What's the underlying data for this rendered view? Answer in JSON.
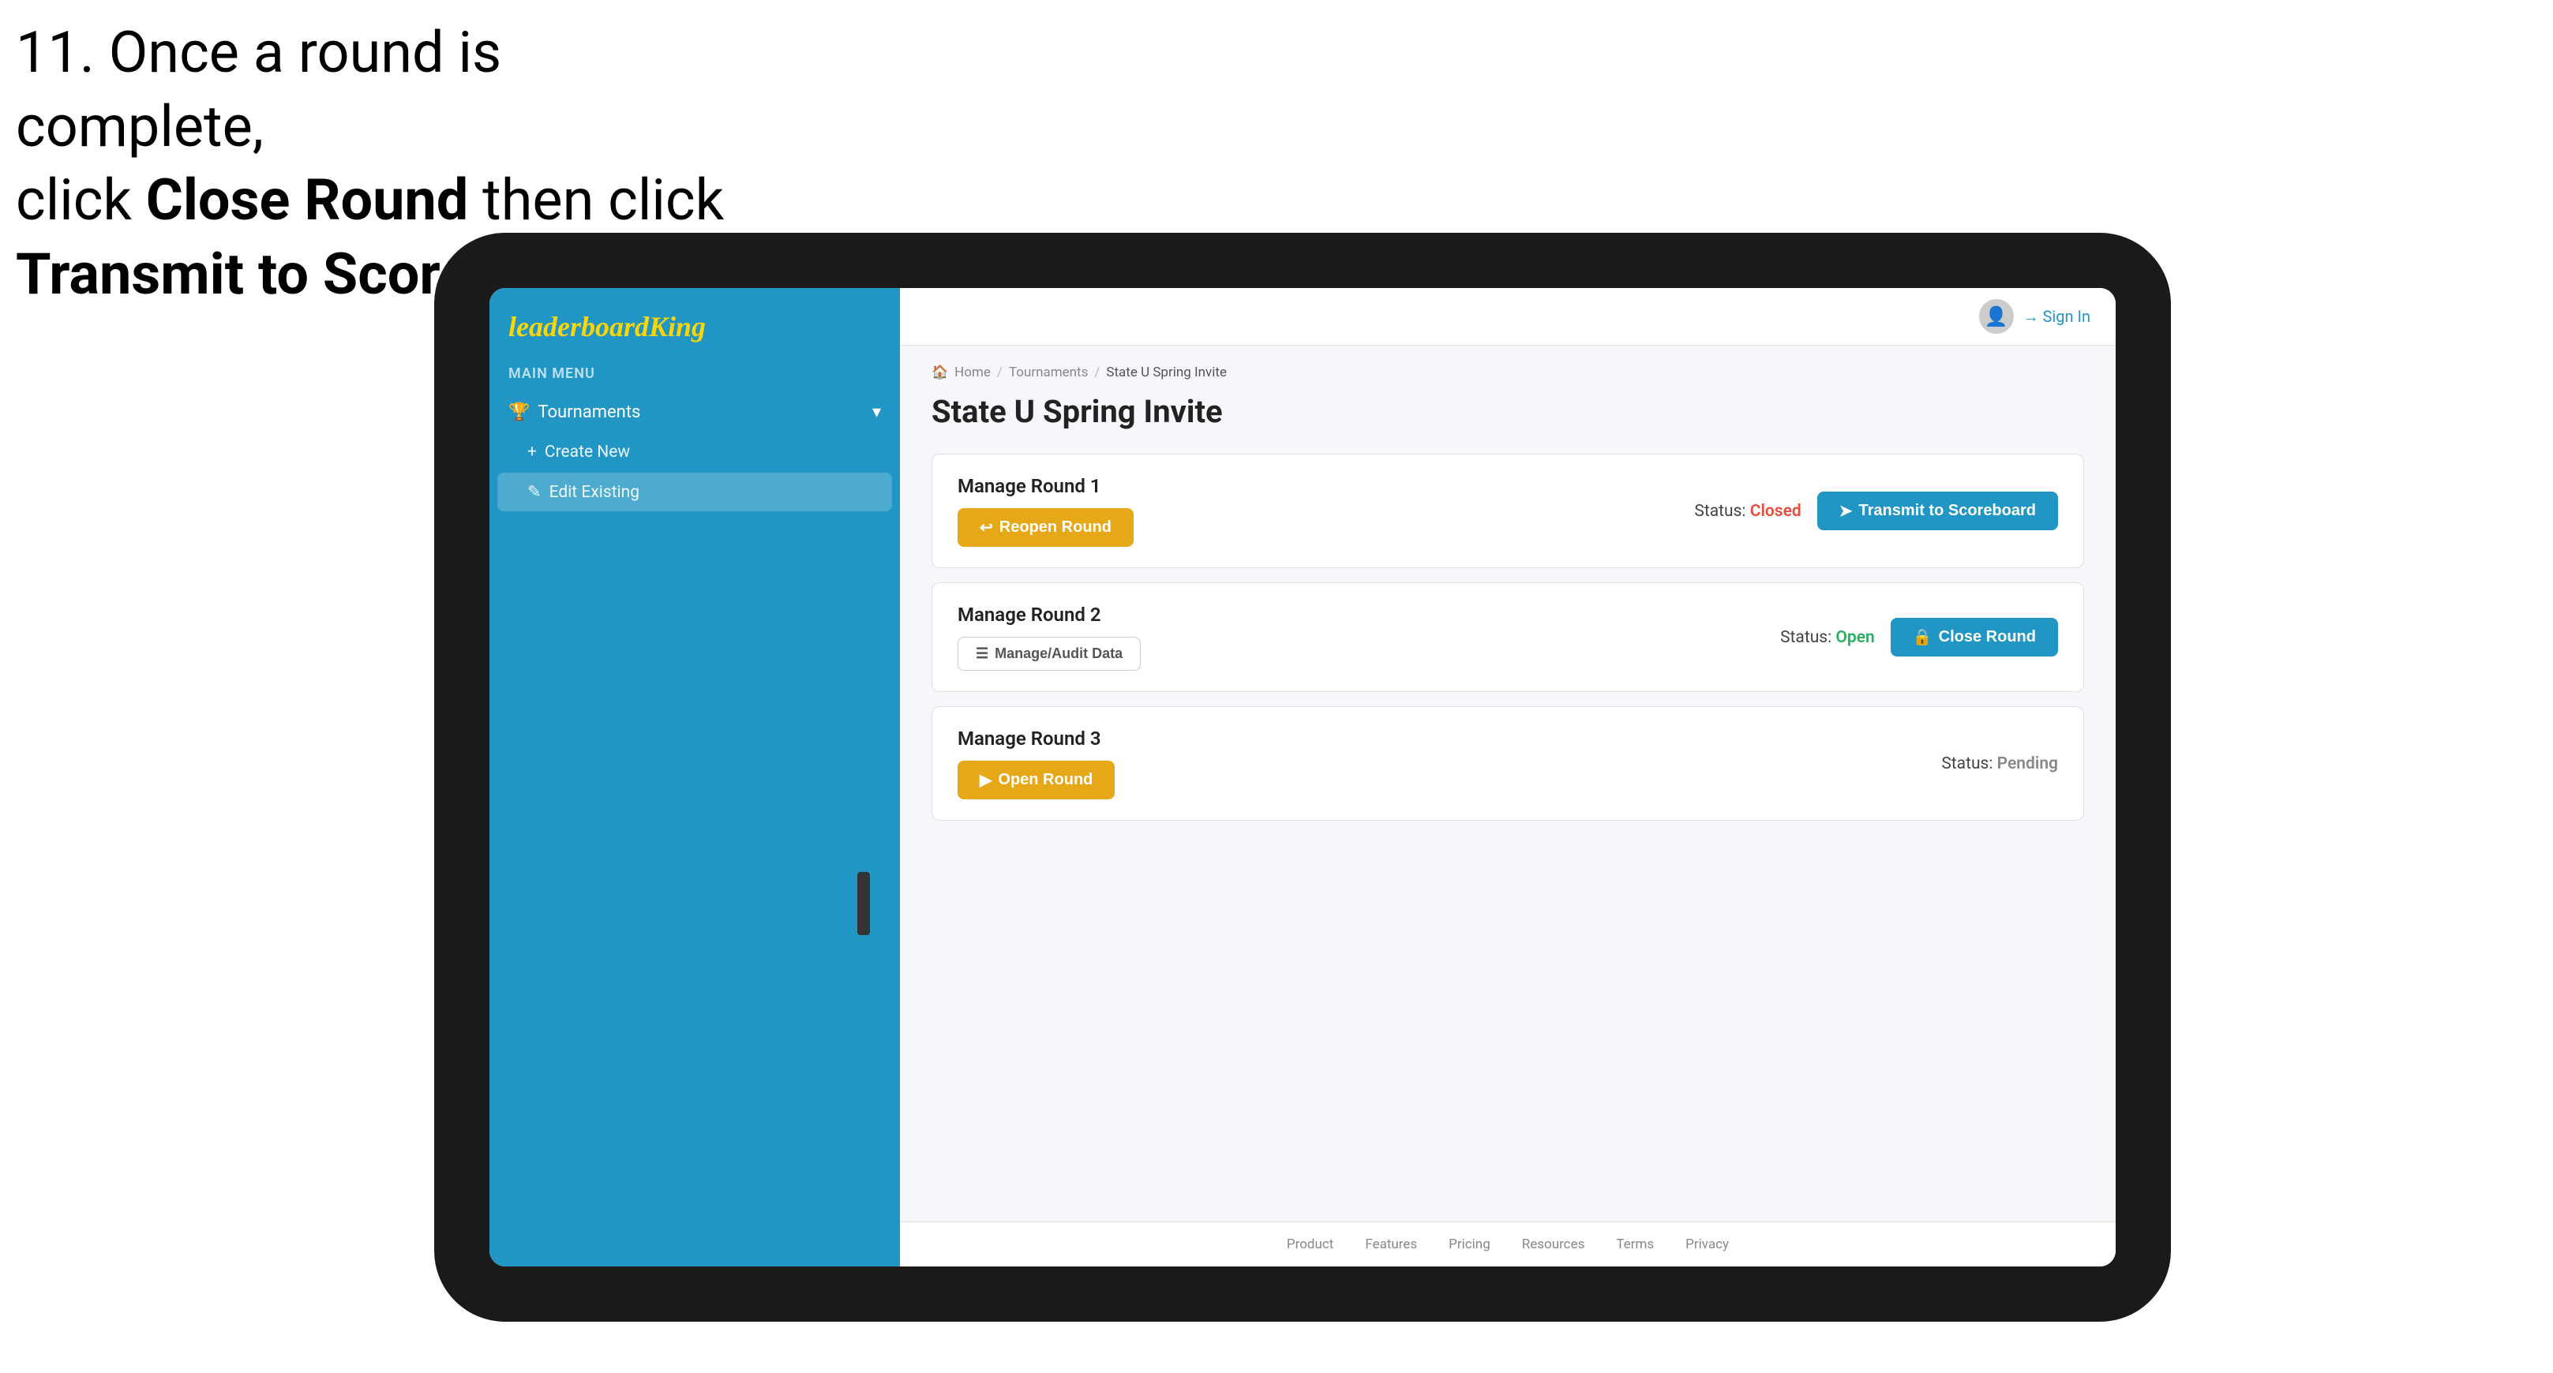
{
  "instruction": {
    "line1": "11. Once a round is complete,",
    "line2": "click ",
    "bold1": "Close Round",
    "line3": " then click",
    "bold2": "Transmit to Scoreboard."
  },
  "sidebar": {
    "logo": {
      "normal": "leaderboard",
      "styled": "King"
    },
    "main_menu_label": "MAIN MENU",
    "nav_items": [
      {
        "label": "Tournaments",
        "icon": "trophy"
      }
    ],
    "sub_items": [
      {
        "label": "Create New",
        "icon": "plus"
      },
      {
        "label": "Edit Existing",
        "icon": "edit",
        "active": true
      }
    ]
  },
  "topbar": {
    "sign_in_label": "→ Sign In"
  },
  "breadcrumb": {
    "home": "Home",
    "tournaments": "Tournaments",
    "current": "State U Spring Invite"
  },
  "page": {
    "title": "State U Spring Invite"
  },
  "rounds": [
    {
      "id": 1,
      "title": "Manage Round 1",
      "status_label": "Status:",
      "status": "Closed",
      "status_class": "status-closed",
      "buttons": [
        {
          "label": "Reopen Round",
          "type": "amber",
          "icon": "reopen"
        }
      ],
      "right_buttons": [
        {
          "label": "Transmit to Scoreboard",
          "type": "blue",
          "icon": "transmit"
        }
      ]
    },
    {
      "id": 2,
      "title": "Manage Round 2",
      "status_label": "Status:",
      "status": "Open",
      "status_class": "status-open",
      "buttons": [
        {
          "label": "Manage/Audit Data",
          "type": "manage",
          "icon": "manage"
        }
      ],
      "right_buttons": [
        {
          "label": "Close Round",
          "type": "blue",
          "icon": "close"
        }
      ]
    },
    {
      "id": 3,
      "title": "Manage Round 3",
      "status_label": "Status:",
      "status": "Pending",
      "status_class": "status-pending",
      "buttons": [
        {
          "label": "Open Round",
          "type": "amber",
          "icon": "open"
        }
      ],
      "right_buttons": []
    }
  ],
  "footer": {
    "links": [
      "Product",
      "Features",
      "Pricing",
      "Resources",
      "Terms",
      "Privacy"
    ]
  },
  "arrow": {
    "color": "#e8174a"
  }
}
